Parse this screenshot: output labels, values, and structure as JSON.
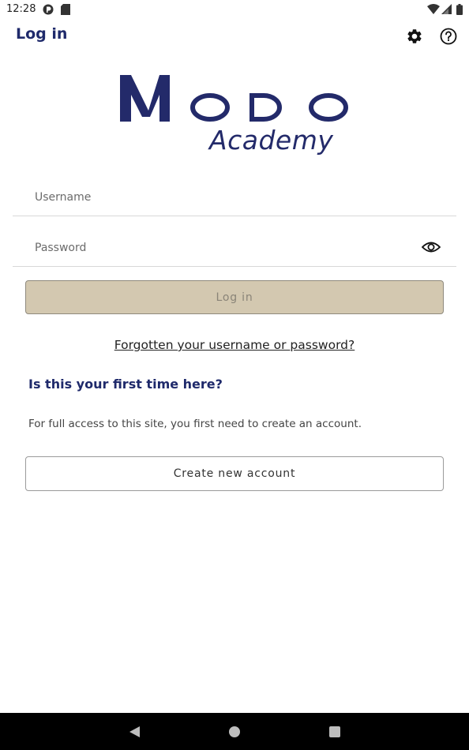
{
  "status_bar": {
    "time": "12:28",
    "icons": [
      "notification-icon",
      "sd-card-icon",
      "wifi-icon",
      "signal-icon",
      "battery-icon"
    ]
  },
  "header": {
    "title": "Log in",
    "settings_icon": "gear-icon",
    "help_icon": "help-icon"
  },
  "logo": {
    "brand": "MODO",
    "subtitle": "Academy",
    "colors": {
      "primary": "#232a6a"
    }
  },
  "form": {
    "username_placeholder": "Username",
    "password_placeholder": "Password",
    "show_password_icon": "eye-icon",
    "login_label": "Log in",
    "forgot_label": "Forgotten your username or password?"
  },
  "signup": {
    "heading": "Is this your first time here?",
    "description": "For full access to this site, you first need to create an account.",
    "create_label": "Create new account"
  },
  "nav_bar": {
    "back_icon": "back-icon",
    "home_icon": "home-icon",
    "recents_icon": "recents-icon"
  },
  "colors": {
    "title": "#1f2a6b",
    "login_button_bg": "#d3c8b0",
    "nav_bar_bg": "#000000"
  }
}
